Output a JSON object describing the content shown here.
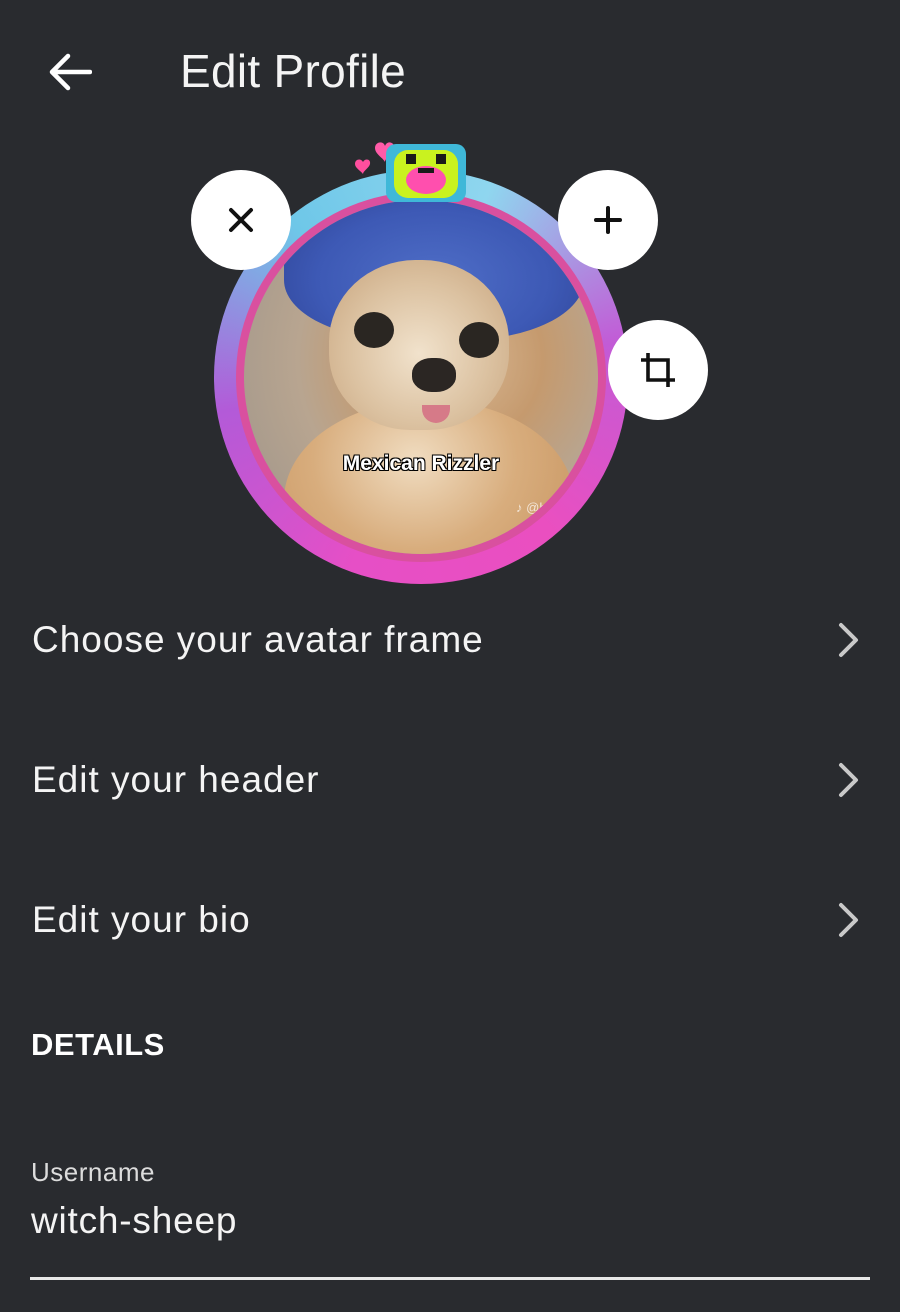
{
  "header": {
    "title": "Edit Profile",
    "back_icon": "arrow-left-icon"
  },
  "avatar": {
    "caption": "Mexican Rizzler",
    "watermark": "@h",
    "frame_colors": [
      "#e64fc6",
      "#6ec7e8",
      "#b35ad8"
    ],
    "actions": {
      "remove_icon": "close-icon",
      "add_icon": "plus-icon",
      "crop_icon": "crop-icon"
    }
  },
  "menu": {
    "items": [
      {
        "label": "Choose your avatar frame",
        "icon": "chevron-right-icon"
      },
      {
        "label": "Edit your header",
        "icon": "chevron-right-icon"
      },
      {
        "label": "Edit your bio",
        "icon": "chevron-right-icon"
      }
    ]
  },
  "details": {
    "heading": "DETAILS",
    "username": {
      "label": "Username",
      "value": "witch-sheep"
    }
  },
  "colors": {
    "background": "#292b2f",
    "text": "#f4f4f4",
    "button_bg": "#ffffff"
  }
}
